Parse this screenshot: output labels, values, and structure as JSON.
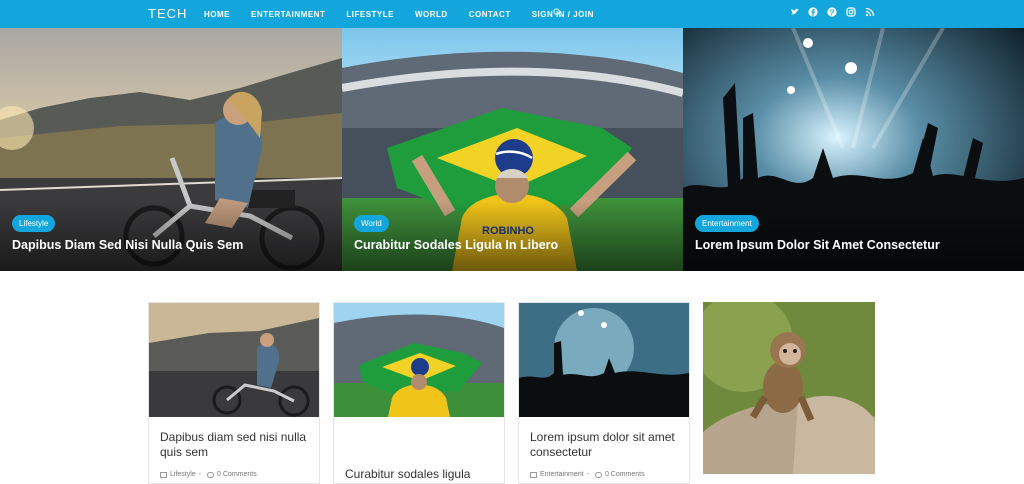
{
  "header": {
    "brand": "TECH",
    "nav": [
      "HOME",
      "ENTERTAINMENT",
      "LIFESTYLE",
      "WORLD",
      "CONTACT",
      "SIGN IN / JOIN"
    ],
    "social_icons": [
      "twitter-icon",
      "facebook-icon",
      "pinterest-icon",
      "instagram-icon",
      "rss-icon"
    ]
  },
  "hero": [
    {
      "category": "Lifestyle",
      "title": "Dapibus Diam Sed Nisi Nulla Quis Sem"
    },
    {
      "category": "World",
      "title": "Curabitur Sodales Ligula In Libero"
    },
    {
      "category": "Entertainment",
      "title": "Lorem Ipsum Dolor Sit Amet Consectetur"
    }
  ],
  "cards": [
    {
      "title": "Dapibus diam sed nisi nulla quis sem",
      "category": "Lifestyle",
      "comments": "0 Comments"
    },
    {
      "title": "Curabitur sodales ligula",
      "category": "",
      "comments": ""
    },
    {
      "title": "Lorem ipsum dolor sit amet consectetur",
      "category": "Entertainment",
      "comments": "0 Comments"
    }
  ],
  "colors": {
    "accent": "#13a6dc"
  }
}
